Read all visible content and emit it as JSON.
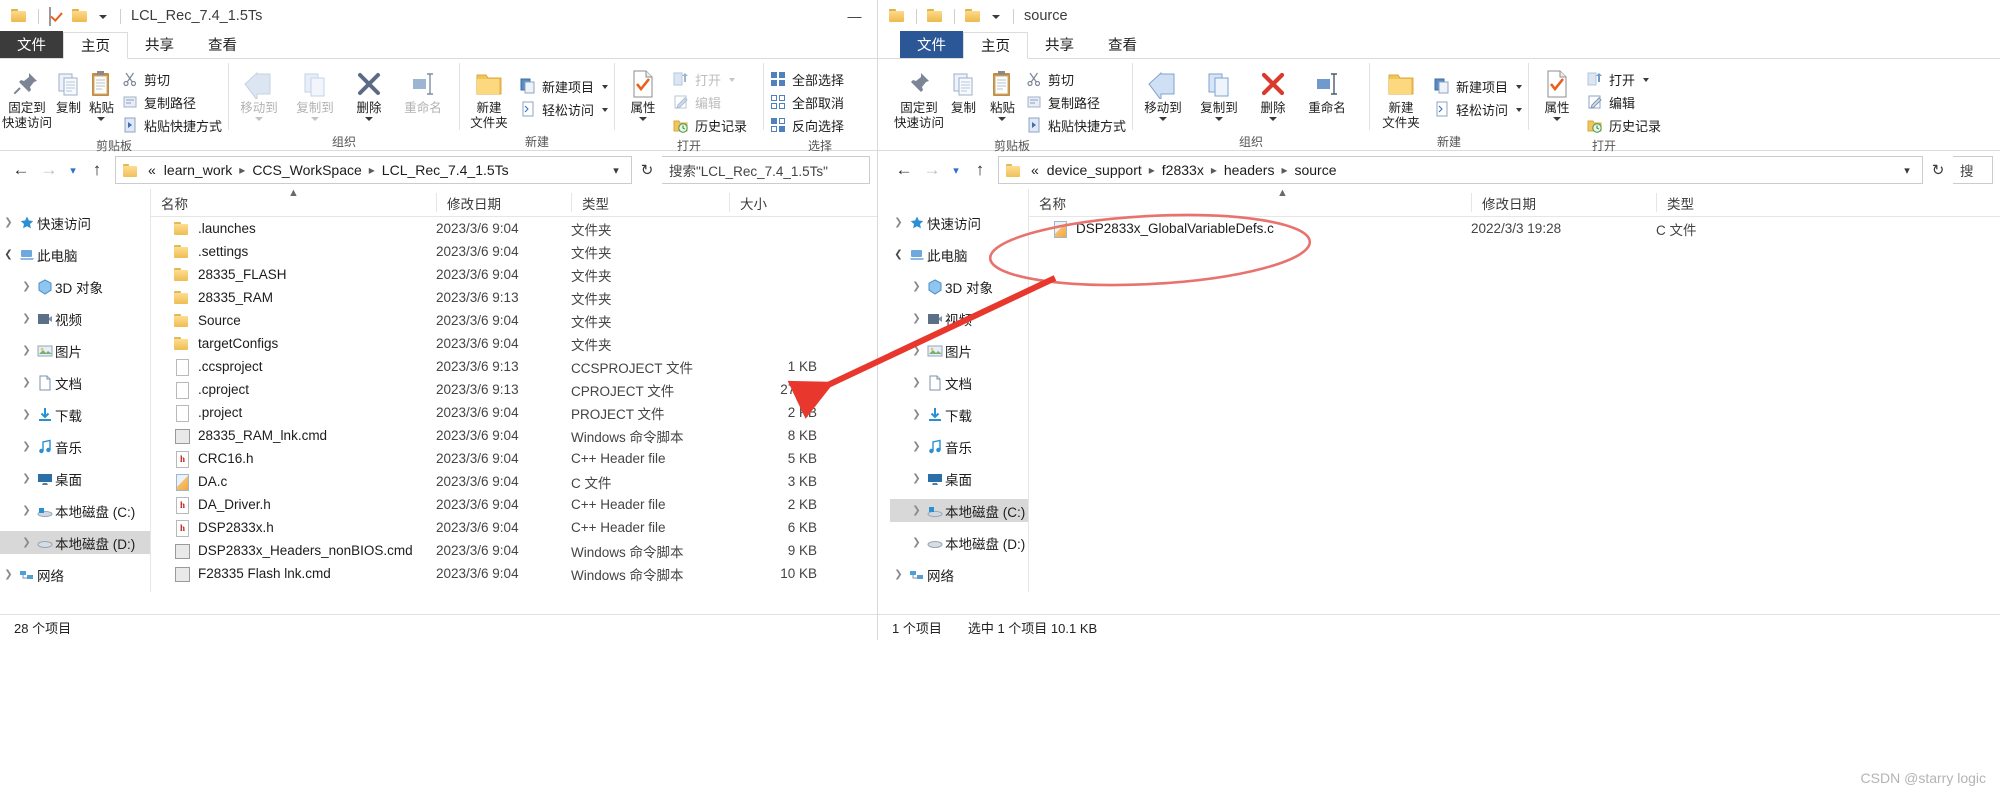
{
  "left_window": {
    "title": "LCL_Rec_7.4_1.5Ts",
    "tabs": {
      "file": "文件",
      "home": "主页",
      "share": "共享",
      "view": "查看"
    },
    "ribbon": {
      "groups": [
        {
          "label": "剪贴板",
          "big": [
            {
              "label1": "固定到",
              "label2": "快速访问",
              "icon": "pin-icon"
            },
            {
              "label1": "复制",
              "label2": "",
              "icon": "copy-icon"
            },
            {
              "label1": "粘贴",
              "label2": "",
              "icon": "paste-icon"
            }
          ],
          "small": [
            {
              "label": "剪切",
              "icon": "scissors-icon"
            },
            {
              "label": "复制路径",
              "icon": "copy-path-icon"
            },
            {
              "label": "粘贴快捷方式",
              "icon": "paste-shortcut-icon"
            }
          ]
        },
        {
          "label": "组织",
          "big": [
            {
              "label1": "移动到",
              "label2": "",
              "icon": "move-to-icon",
              "dim": true,
              "caret": true
            },
            {
              "label1": "复制到",
              "label2": "",
              "icon": "copy-to-icon",
              "dim": true,
              "caret": true
            },
            {
              "label1": "删除",
              "label2": "",
              "icon": "delete-icon",
              "caret": true
            },
            {
              "label1": "重命名",
              "label2": "",
              "icon": "rename-icon",
              "dim": true
            }
          ],
          "small": []
        },
        {
          "label": "新建",
          "big": [
            {
              "label1": "新建",
              "label2": "文件夹",
              "icon": "new-folder-icon"
            }
          ],
          "small": [
            {
              "label": "新建项目",
              "icon": "new-item-icon",
              "caret": true
            },
            {
              "label": "轻松访问",
              "icon": "easy-access-icon",
              "caret": true
            }
          ]
        },
        {
          "label": "打开",
          "big": [
            {
              "label1": "属性",
              "label2": "",
              "icon": "properties-icon",
              "caret": true
            }
          ],
          "small": [
            {
              "label": "打开",
              "icon": "open-icon",
              "dim": true,
              "caret": true
            },
            {
              "label": "编辑",
              "icon": "edit-icon",
              "dim": true
            },
            {
              "label": "历史记录",
              "icon": "history-icon"
            }
          ]
        },
        {
          "label": "选择",
          "big": [],
          "small": [
            {
              "label": "全部选择",
              "icon": "select-all-icon"
            },
            {
              "label": "全部取消",
              "icon": "select-none-icon"
            },
            {
              "label": "反向选择",
              "icon": "invert-selection-icon"
            }
          ]
        }
      ]
    },
    "address": {
      "root_chevron": "«",
      "crumbs": [
        "learn_work",
        "CCS_WorkSpace",
        "LCL_Rec_7.4_1.5Ts"
      ],
      "search_text": "搜索\"LCL_Rec_7.4_1.5Ts\""
    },
    "nav": [
      {
        "label": "快速访问",
        "icon": "star-icon",
        "chevron": "collapsed",
        "indent": 0
      },
      {
        "label": "此电脑",
        "icon": "this-pc-icon",
        "chevron": "expanded",
        "indent": 0
      },
      {
        "label": "3D 对象",
        "icon": "3d-objects-icon",
        "chevron": "collapsed",
        "indent": 1
      },
      {
        "label": "视频",
        "icon": "videos-icon",
        "chevron": "collapsed",
        "indent": 1
      },
      {
        "label": "图片",
        "icon": "pictures-icon",
        "chevron": "collapsed",
        "indent": 1
      },
      {
        "label": "文档",
        "icon": "documents-icon",
        "chevron": "collapsed",
        "indent": 1
      },
      {
        "label": "下载",
        "icon": "downloads-icon",
        "chevron": "collapsed",
        "indent": 1
      },
      {
        "label": "音乐",
        "icon": "music-icon",
        "chevron": "collapsed",
        "indent": 1
      },
      {
        "label": "桌面",
        "icon": "desktop-icon",
        "chevron": "collapsed",
        "indent": 1
      },
      {
        "label": "本地磁盘 (C:)",
        "icon": "local-disk-c-icon",
        "chevron": "collapsed",
        "indent": 1
      },
      {
        "label": "本地磁盘 (D:)",
        "icon": "local-disk-d-icon",
        "chevron": "collapsed",
        "indent": 1,
        "selected": true
      },
      {
        "label": "网络",
        "icon": "network-icon",
        "chevron": "collapsed",
        "indent": 0
      }
    ],
    "columns": [
      "名称",
      "修改日期",
      "类型",
      "大小"
    ],
    "files": [
      {
        "name": ".launches",
        "date": "2023/3/6 9:04",
        "type": "文件夹",
        "size": "",
        "icon": "folder-icon"
      },
      {
        "name": ".settings",
        "date": "2023/3/6 9:04",
        "type": "文件夹",
        "size": "",
        "icon": "folder-icon"
      },
      {
        "name": "28335_FLASH",
        "date": "2023/3/6 9:04",
        "type": "文件夹",
        "size": "",
        "icon": "folder-icon"
      },
      {
        "name": "28335_RAM",
        "date": "2023/3/6 9:13",
        "type": "文件夹",
        "size": "",
        "icon": "folder-icon"
      },
      {
        "name": "Source",
        "date": "2023/3/6 9:04",
        "type": "文件夹",
        "size": "",
        "icon": "folder-icon"
      },
      {
        "name": "targetConfigs",
        "date": "2023/3/6 9:04",
        "type": "文件夹",
        "size": "",
        "icon": "folder-icon"
      },
      {
        "name": ".ccsproject",
        "date": "2023/3/6 9:13",
        "type": "CCSPROJECT 文件",
        "size": "1 KB",
        "icon": "blank-file-icon"
      },
      {
        "name": ".cproject",
        "date": "2023/3/6 9:13",
        "type": "CPROJECT 文件",
        "size": "27 KB",
        "icon": "blank-file-icon"
      },
      {
        "name": ".project",
        "date": "2023/3/6 9:04",
        "type": "PROJECT 文件",
        "size": "2 KB",
        "icon": "blank-file-icon"
      },
      {
        "name": "28335_RAM_lnk.cmd",
        "date": "2023/3/6 9:04",
        "type": "Windows 命令脚本",
        "size": "8 KB",
        "icon": "cmd-file-icon"
      },
      {
        "name": "CRC16.h",
        "date": "2023/3/6 9:04",
        "type": "C++ Header file",
        "size": "5 KB",
        "icon": "h-file-icon"
      },
      {
        "name": "DA.c",
        "date": "2023/3/6 9:04",
        "type": "C 文件",
        "size": "3 KB",
        "icon": "c-file-icon"
      },
      {
        "name": "DA_Driver.h",
        "date": "2023/3/6 9:04",
        "type": "C++ Header file",
        "size": "2 KB",
        "icon": "h-file-icon"
      },
      {
        "name": "DSP2833x.h",
        "date": "2023/3/6 9:04",
        "type": "C++ Header file",
        "size": "6 KB",
        "icon": "h-file-icon"
      },
      {
        "name": "DSP2833x_Headers_nonBIOS.cmd",
        "date": "2023/3/6 9:04",
        "type": "Windows 命令脚本",
        "size": "9 KB",
        "icon": "cmd-file-icon"
      },
      {
        "name": "F28335 Flash  lnk.cmd",
        "date": "2023/3/6 9:04",
        "type": "Windows 命令脚本",
        "size": "10 KB",
        "icon": "cmd-file-icon"
      }
    ],
    "status": {
      "count": "28 个项目",
      "selection": ""
    }
  },
  "right_window": {
    "title": "source",
    "tabs": {
      "file": "文件",
      "home": "主页",
      "share": "共享",
      "view": "查看"
    },
    "ribbon": {
      "groups": [
        {
          "label": "剪贴板",
          "big": [
            {
              "label1": "固定到",
              "label2": "快速访问",
              "icon": "pin-icon"
            },
            {
              "label1": "复制",
              "label2": "",
              "icon": "copy-icon"
            },
            {
              "label1": "粘贴",
              "label2": "",
              "icon": "paste-icon"
            }
          ],
          "small": [
            {
              "label": "剪切",
              "icon": "scissors-icon"
            },
            {
              "label": "复制路径",
              "icon": "copy-path-icon"
            },
            {
              "label": "粘贴快捷方式",
              "icon": "paste-shortcut-icon"
            }
          ]
        },
        {
          "label": "组织",
          "big": [
            {
              "label1": "移动到",
              "label2": "",
              "icon": "move-to-icon",
              "caret": true
            },
            {
              "label1": "复制到",
              "label2": "",
              "icon": "copy-to-icon",
              "caret": true
            },
            {
              "label1": "删除",
              "label2": "",
              "icon": "delete-icon",
              "caret": true
            },
            {
              "label1": "重命名",
              "label2": "",
              "icon": "rename-icon"
            }
          ],
          "small": []
        },
        {
          "label": "新建",
          "big": [
            {
              "label1": "新建",
              "label2": "文件夹",
              "icon": "new-folder-icon"
            }
          ],
          "small": [
            {
              "label": "新建项目",
              "icon": "new-item-icon",
              "caret": true
            },
            {
              "label": "轻松访问",
              "icon": "easy-access-icon",
              "caret": true
            }
          ]
        },
        {
          "label": "打开",
          "big": [
            {
              "label1": "属性",
              "label2": "",
              "icon": "properties-icon",
              "caret": true
            }
          ],
          "small": [
            {
              "label": "打开",
              "icon": "open-icon",
              "caret": true
            },
            {
              "label": "编辑",
              "icon": "edit-icon"
            },
            {
              "label": "历史记录",
              "icon": "history-icon"
            }
          ]
        }
      ]
    },
    "address": {
      "root_chevron": "«",
      "crumbs": [
        "device_support",
        "f2833x",
        "headers",
        "source"
      ],
      "search_text": "搜"
    },
    "nav": [
      {
        "label": "快速访问",
        "icon": "star-icon",
        "chevron": "collapsed",
        "indent": 0
      },
      {
        "label": "此电脑",
        "icon": "this-pc-icon",
        "chevron": "expanded",
        "indent": 0
      },
      {
        "label": "3D 对象",
        "icon": "3d-objects-icon",
        "chevron": "collapsed",
        "indent": 1
      },
      {
        "label": "视频",
        "icon": "videos-icon",
        "chevron": "collapsed",
        "indent": 1
      },
      {
        "label": "图片",
        "icon": "pictures-icon",
        "chevron": "collapsed",
        "indent": 1
      },
      {
        "label": "文档",
        "icon": "documents-icon",
        "chevron": "collapsed",
        "indent": 1
      },
      {
        "label": "下载",
        "icon": "downloads-icon",
        "chevron": "collapsed",
        "indent": 1
      },
      {
        "label": "音乐",
        "icon": "music-icon",
        "chevron": "collapsed",
        "indent": 1
      },
      {
        "label": "桌面",
        "icon": "desktop-icon",
        "chevron": "collapsed",
        "indent": 1
      },
      {
        "label": "本地磁盘 (C:)",
        "icon": "local-disk-c-icon",
        "chevron": "collapsed",
        "indent": 1,
        "selected": true
      },
      {
        "label": "本地磁盘 (D:)",
        "icon": "local-disk-d-icon",
        "chevron": "collapsed",
        "indent": 1
      },
      {
        "label": "网络",
        "icon": "network-icon",
        "chevron": "collapsed",
        "indent": 0
      }
    ],
    "columns": [
      "名称",
      "修改日期",
      "类型"
    ],
    "files": [
      {
        "name": "DSP2833x_GlobalVariableDefs.c",
        "date": "2022/3/3 19:28",
        "type": "C 文件",
        "icon": "c-file-icon",
        "selected": true
      }
    ],
    "status": {
      "count": "1 个项目",
      "selection": "选中 1 个项目 10.1 KB"
    }
  },
  "annotation": {
    "ellipse_color": "#e8736e",
    "arrow_color": "#e8372c",
    "target_file": "DSP2833x_GlobalVariableDefs.c"
  },
  "watermark": "CSDN @starry logic"
}
